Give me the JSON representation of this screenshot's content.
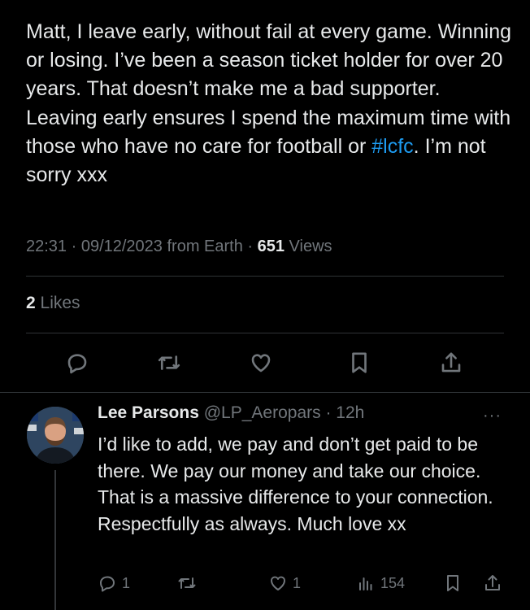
{
  "tweet": {
    "text_part1": "Matt, I leave early, without fail at every game. Winning or losing. I’ve been a season ticket holder for over 20 years. That doesn’t make me a bad supporter. Leaving early ensures I spend the maximum time with those who have no care for football or ",
    "hashtag": "#lcfc",
    "text_part2": ". I’m not sorry xxx",
    "timestamp": "22:31 · 09/12/2023 from Earth · ",
    "views_count": "651",
    "views_label": " Views",
    "likes_count": "2",
    "likes_label": " Likes"
  },
  "actions": {
    "icons": [
      "reply-icon",
      "retweet-icon",
      "like-icon",
      "bookmark-icon",
      "share-icon"
    ]
  },
  "reply": {
    "name": "Lee Parsons",
    "handle_time": " @LP_Aeropars · 12h",
    "more": "···",
    "text": "I’d like to add, we pay and don’t get paid to be there. We pay our money and take our choice. That is a massive difference to your connection.  Respectfully as always. Much love xx",
    "reply_count": "1",
    "like_count": "1",
    "views_count": "154"
  },
  "colors": {
    "background": "#000000",
    "text": "#e7e9ea",
    "secondary": "#71767b",
    "accent": "#1d9bf0",
    "divider": "#2f3336"
  }
}
